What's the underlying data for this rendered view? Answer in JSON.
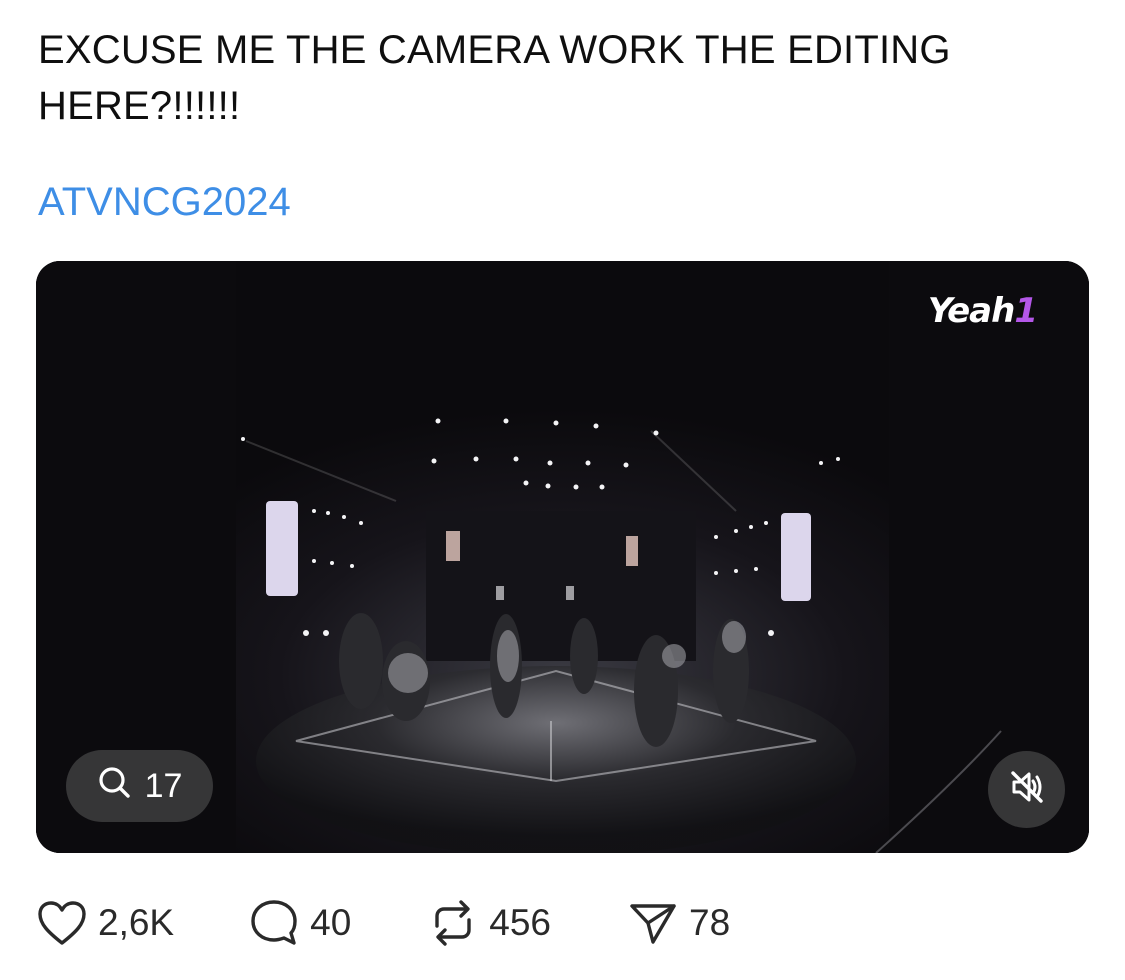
{
  "post": {
    "text": "EXCUSE ME THE CAMERA WORK THE EDITING HERE?!!!!!!",
    "hashtag": "ATVNCG2024"
  },
  "video": {
    "watermark": "Yeah",
    "watermark_suffix": "1",
    "replies_count": "17",
    "muted": true
  },
  "actions": {
    "likes": "2,6K",
    "replies": "40",
    "reposts": "456",
    "shares": "78"
  },
  "colors": {
    "hashtag": "#3e8ee6",
    "logo_accent": "#b457e8",
    "pill_bg": "#3c3c3e"
  },
  "icons": {
    "replies_pill": "search-icon",
    "mute": "speaker-muted-icon",
    "like": "heart-icon",
    "reply": "comment-bubble-icon",
    "repost": "repost-arrows-icon",
    "share": "send-paper-plane-icon"
  }
}
